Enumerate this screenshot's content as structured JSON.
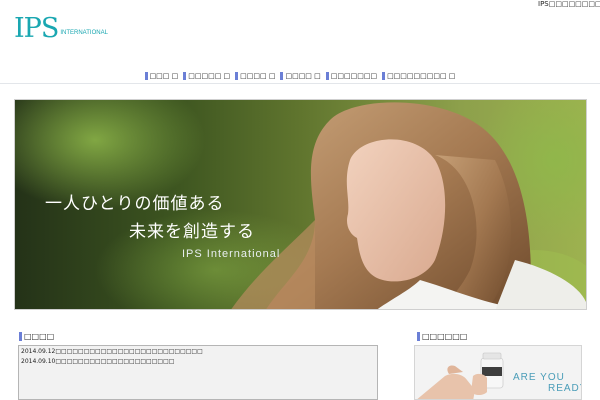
{
  "header": {
    "logo": {
      "mark": "IPS",
      "sub": "INTERNATIONAL"
    },
    "tagline": "IPS□□□□□□□□□□□□□□"
  },
  "nav": {
    "items": [
      {
        "label": "□□□ □"
      },
      {
        "label": "□□□□□ □"
      },
      {
        "label": "□□□□ □"
      },
      {
        "label": "□□□□ □"
      },
      {
        "label": "□□□□□□□"
      },
      {
        "label": "□□□□□□□□□ □"
      }
    ]
  },
  "hero": {
    "line1": "一人ひとりの価値ある",
    "line2": "未来を創造する",
    "brand": "IPS International"
  },
  "news": {
    "title": "□□□□",
    "items": [
      {
        "text": "2014.09.12□□□□□□□□□□□□□□□□□□□□□□□□□□"
      },
      {
        "text": "2014.09.10□□□□□□□□□□□□□□□□□□□□□"
      }
    ]
  },
  "sidebar": {
    "title": "□□□□□□",
    "promo": {
      "line1": "ARE YOU",
      "line2": "READY?"
    }
  },
  "colors": {
    "brand_teal": "#1aa7b1",
    "nav_marker": "#6b7fd6",
    "promo_text": "#4a9db8"
  },
  "icons": {
    "nav_marker": "blue-bar-marker",
    "promo_product": "supplement-bottle"
  }
}
